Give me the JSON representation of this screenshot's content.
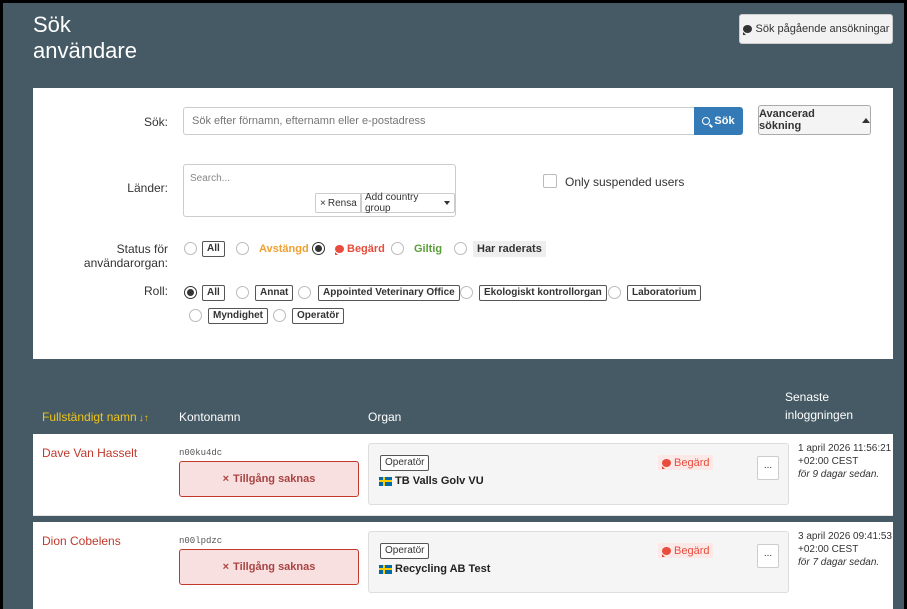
{
  "header": {
    "title_line1": "Sök",
    "title_line2": "användare",
    "ongoing_button": "Sök pågående ansökningar"
  },
  "search": {
    "label": "Sök:",
    "placeholder": "Sök efter förnamn, efternamn eller e-postadress",
    "button": "Sök",
    "advanced_button": "Avancerad sökning"
  },
  "countries": {
    "label": "Länder:",
    "placeholder": "Search...",
    "clear_button": "Rensa",
    "group_button": "Add country group"
  },
  "suspended": {
    "label": "Only suspended users",
    "checked": false
  },
  "status_filter": {
    "label": "Status för användarorgan:",
    "options": [
      "All",
      "Avstängd",
      "Begärd",
      "Giltig",
      "Har raderats"
    ],
    "selected": "Begärd",
    "colors": {
      "Avstängd": "#f0a030",
      "Begärd": "#e74c3c",
      "Giltig": "#5a9e3a"
    }
  },
  "role_filter": {
    "label": "Roll:",
    "options": [
      "All",
      "Annat",
      "Appointed Veterinary Office",
      "Ekologiskt kontrollorgan",
      "Laboratorium",
      "Myndighet",
      "Operatör"
    ],
    "selected": "All"
  },
  "table": {
    "headers": {
      "full_name": "Fullständigt namn",
      "account": "Kontonamn",
      "organ": "Organ",
      "last_login_1": "Senaste",
      "last_login_2": "inloggningen"
    },
    "rows": [
      {
        "name": "Dave Van Hasselt",
        "account": "n00ku4dc",
        "access": "Tillgång saknas",
        "role": "Operatör",
        "org": "TB Valls Golv VU",
        "status": "Begärd",
        "more": "...",
        "login_date": "1 april 2026 11:56:21",
        "login_tz": "+02:00 CEST",
        "login_ago": "för 9 dagar sedan."
      },
      {
        "name": "Dion Cobelens",
        "account": "n00lpdzc",
        "access": "Tillgång saknas",
        "role": "Operatör",
        "org": "Recycling AB Test",
        "status": "Begärd",
        "more": "...",
        "login_date": "3 april 2026 09:41:53",
        "login_tz": "+02:00 CEST",
        "login_ago": "för 7 dagar sedan."
      }
    ]
  }
}
